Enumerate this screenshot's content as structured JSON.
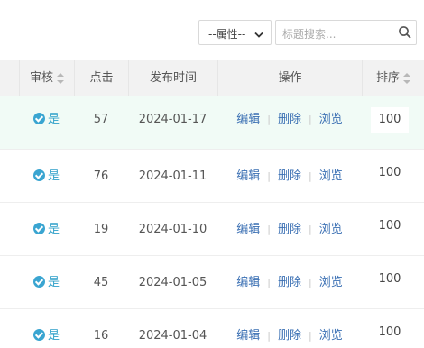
{
  "toolbar": {
    "attr_select": "--属性--",
    "search_placeholder": "标题搜索..."
  },
  "table": {
    "headers": {
      "review": "审核",
      "clicks": "点击",
      "publish_time": "发布时间",
      "actions": "操作",
      "sort": "排序"
    },
    "rows": [
      {
        "review": "是",
        "clicks": "57",
        "date": "2024-01-17",
        "edit": "编辑",
        "delete": "删除",
        "view": "浏览",
        "order": "100"
      },
      {
        "review": "是",
        "clicks": "76",
        "date": "2024-01-11",
        "edit": "编辑",
        "delete": "删除",
        "view": "浏览",
        "order": "100"
      },
      {
        "review": "是",
        "clicks": "19",
        "date": "2024-01-10",
        "edit": "编辑",
        "delete": "删除",
        "view": "浏览",
        "order": "100"
      },
      {
        "review": "是",
        "clicks": "45",
        "date": "2024-01-05",
        "edit": "编辑",
        "delete": "删除",
        "view": "浏览",
        "order": "100"
      },
      {
        "review": "是",
        "clicks": "16",
        "date": "2024-01-04",
        "edit": "编辑",
        "delete": "删除",
        "view": "浏览",
        "order": "100"
      }
    ]
  },
  "colors": {
    "status": "#2fa0c9",
    "link": "#3a6fb3",
    "highlight_row": "#f1fbf6",
    "header_bg": "#f2f2f2"
  },
  "icons": {
    "select": "chevron-down-icon",
    "search": "search-icon",
    "status": "check-circle-icon",
    "sort": "sort-icon"
  }
}
